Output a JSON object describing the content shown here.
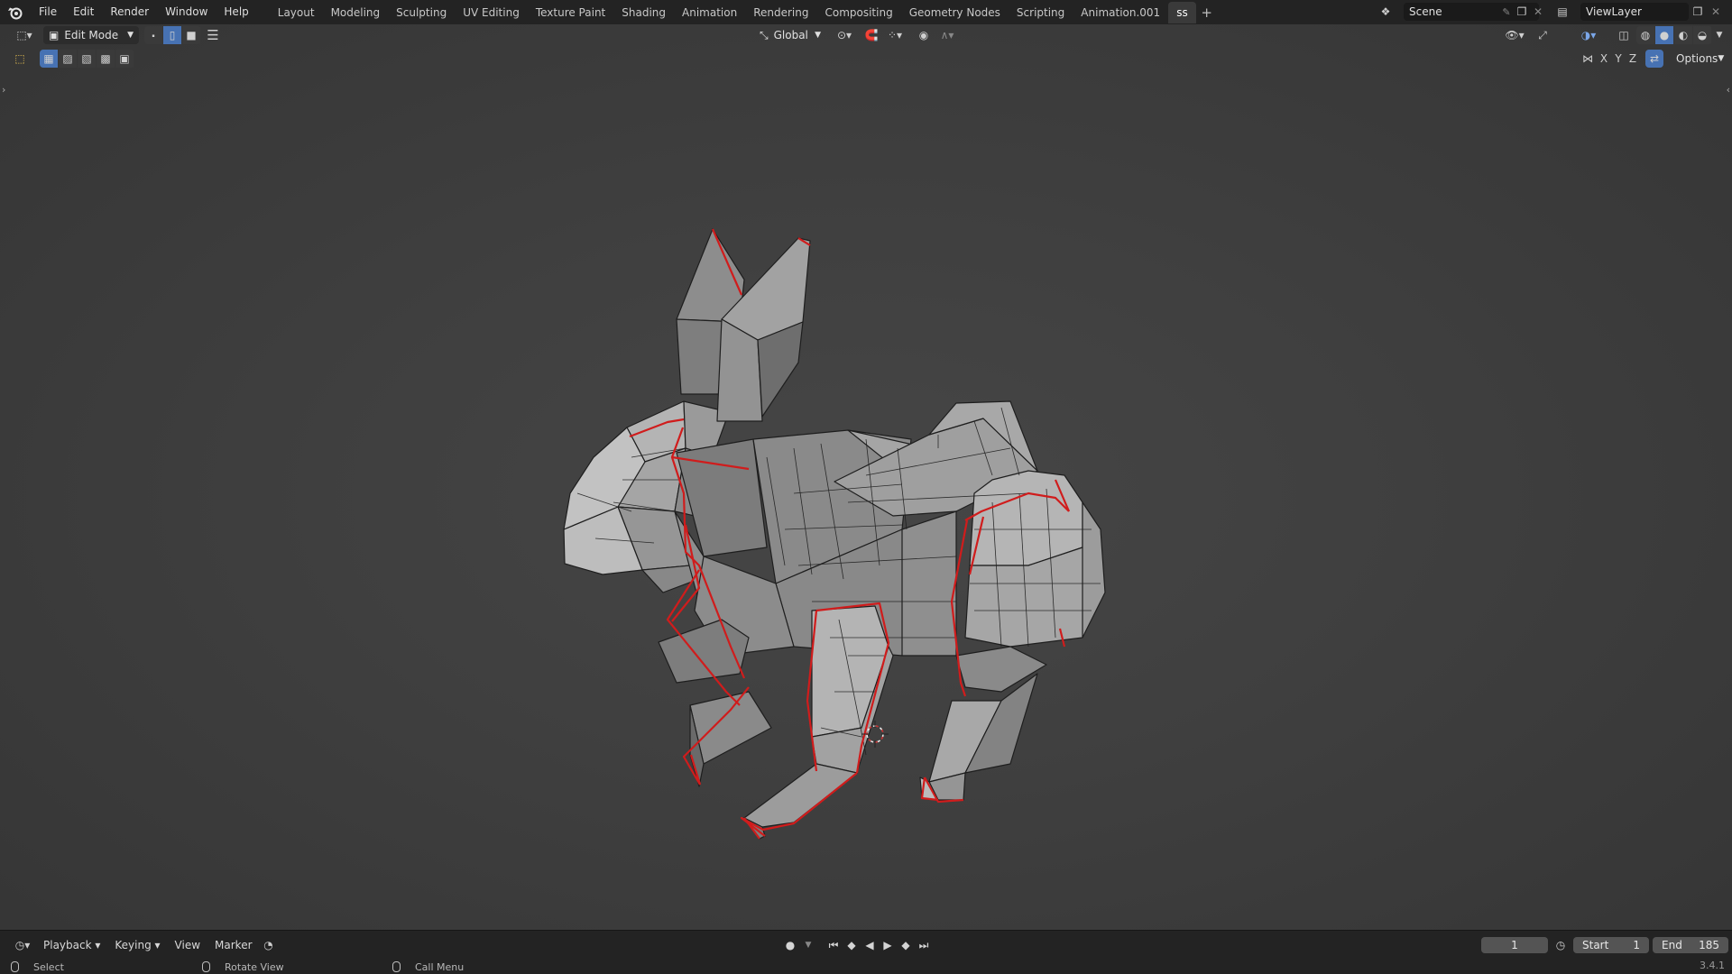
{
  "app": {
    "logo_icon": "blender-logo-icon",
    "menu": [
      "File",
      "Edit",
      "Render",
      "Window",
      "Help"
    ],
    "workspaces": [
      "Layout",
      "Modeling",
      "Sculpting",
      "UV Editing",
      "Texture Paint",
      "Shading",
      "Animation",
      "Rendering",
      "Compositing",
      "Geometry Nodes",
      "Scripting",
      "Animation.001",
      "ss"
    ],
    "active_workspace": "ss",
    "add_workspace": "+",
    "scene_label": "Scene",
    "viewlayer_label": "ViewLayer"
  },
  "viewport": {
    "mode": "Edit Mode",
    "transform_orientation": "Global",
    "axes": [
      "X",
      "Y",
      "Z"
    ],
    "options_label": "Options",
    "select_mode": "edge",
    "seam_color": "#d01c1c",
    "mesh_color": "#8c8c8c"
  },
  "timeline": {
    "menus": [
      "Playback",
      "Keying",
      "View",
      "Marker"
    ],
    "current_frame": "1",
    "start_label": "Start",
    "start_value": "1",
    "end_label": "End",
    "end_value": "185"
  },
  "status": {
    "select": "Select",
    "rotate": "Rotate View",
    "call_menu": "Call Menu",
    "version": "3.4.1"
  }
}
